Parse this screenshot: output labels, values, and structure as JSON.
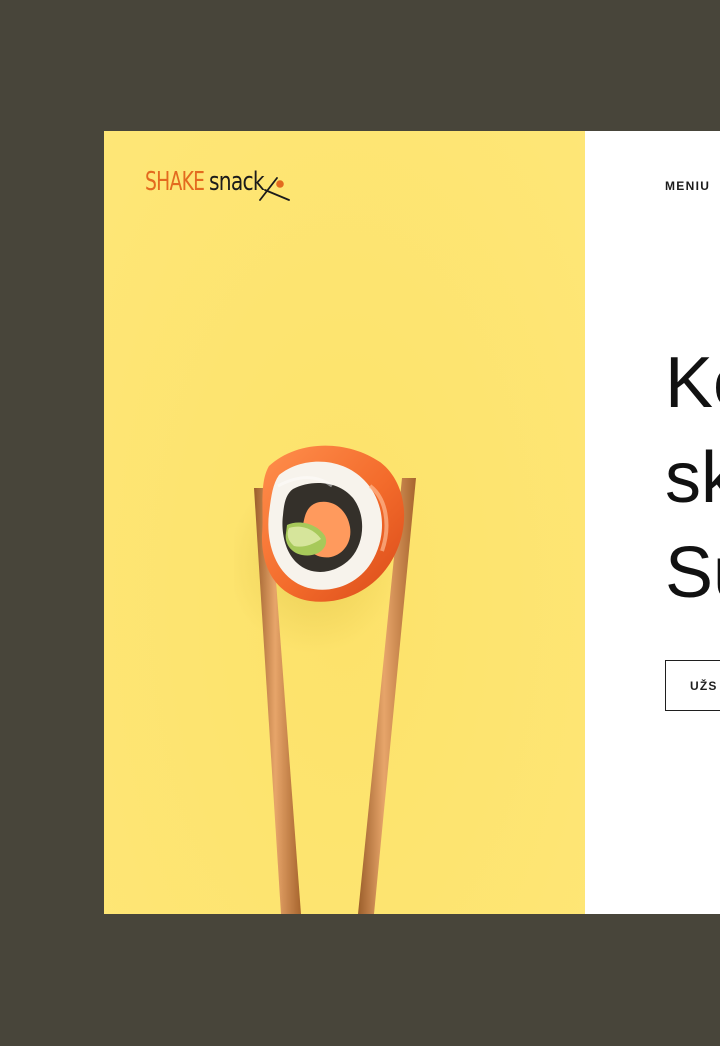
{
  "brand": {
    "logo_part_1": "SHAKE",
    "logo_part_2": "snack",
    "primary_color": "#e36a1f",
    "dark_text_color": "#1b1b1b"
  },
  "navigation": {
    "menu_label": "MENIU"
  },
  "hero": {
    "heading_lines": [
      "Ko",
      "sk",
      "Su"
    ],
    "button_label": "UŽS"
  },
  "theme": {
    "background_color": "#48453a",
    "left_panel_color": "#fde26a",
    "right_panel_color": "#ffffff"
  },
  "media": {
    "hero_image": "sushi roll held by chopsticks"
  }
}
